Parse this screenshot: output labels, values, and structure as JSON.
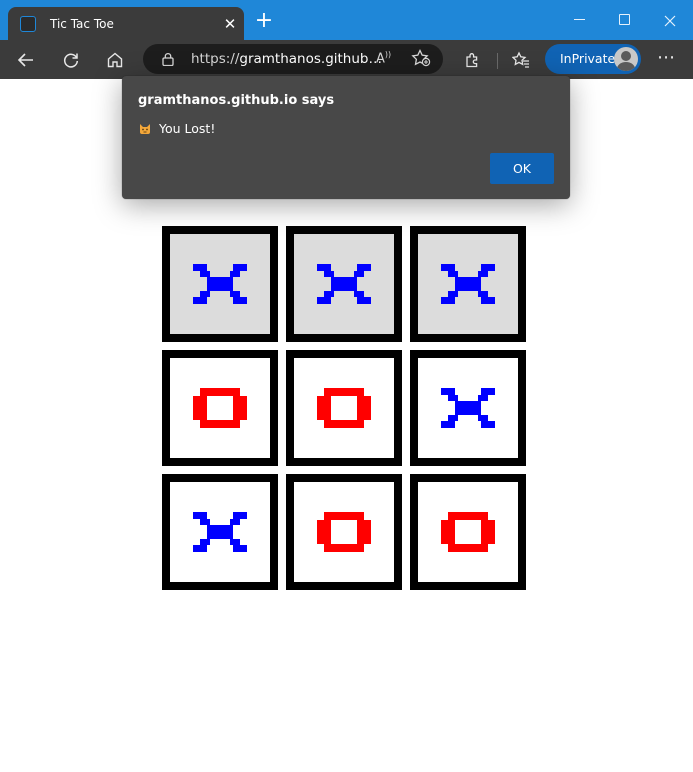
{
  "browser": {
    "tab_title": "Tic Tac Toe",
    "tab_close": "✕",
    "new_tab": "+",
    "address": {
      "url_prefix": "https://",
      "url_host": "gramthanos.github…"
    },
    "read_aloud": "A",
    "profile_label": "InPrivate",
    "more_menu": "⋯"
  },
  "dialog": {
    "title": "gramthanos.github.io says",
    "message": "You Lost!",
    "emoji": "cat-face-emoji",
    "ok_label": "OK"
  },
  "game": {
    "board": [
      [
        "X",
        "X",
        "X"
      ],
      [
        "O",
        "O",
        "X"
      ],
      [
        "X",
        "O",
        "O"
      ]
    ],
    "winning_line": [
      [
        0,
        0
      ],
      [
        0,
        1
      ],
      [
        0,
        2
      ]
    ],
    "colors": {
      "x": "#0000ff",
      "o": "#ff0000",
      "winning_cell": "#dcdcdc",
      "cell": "#ffffff",
      "border": "#000000"
    }
  },
  "theme": {
    "titlebar": "#1f87d8",
    "toolbar": "#3b3b3b",
    "dialog_bg": "#484848",
    "accent": "#1063b4"
  }
}
